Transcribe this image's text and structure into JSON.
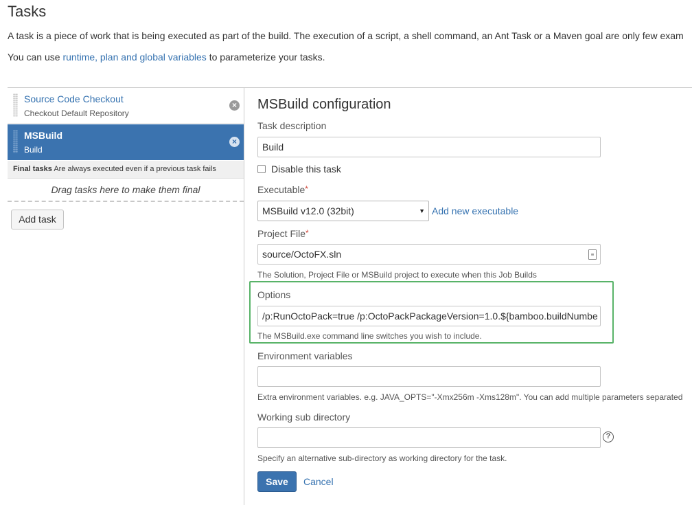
{
  "page": {
    "title": "Tasks",
    "intro": "A task is a piece of work that is being executed as part of the build. The execution of a script, a shell command, an Ant Task or a Maven goal are only few exam",
    "vars_prefix": "You can use ",
    "vars_link": "runtime, plan and global variables",
    "vars_suffix": " to parameterize your tasks."
  },
  "tasks": [
    {
      "name": "Source Code Checkout",
      "sub": "Checkout Default Repository",
      "remove_glyph": "×"
    },
    {
      "name": "MSBuild",
      "sub": "Build",
      "remove_glyph": "×"
    }
  ],
  "final_tasks": {
    "title": "Final tasks",
    "description": "Are always executed even if a previous task fails",
    "drop_hint": "Drag tasks here to make them final"
  },
  "add_task_label": "Add task",
  "config": {
    "title": "MSBuild configuration",
    "task_description_label": "Task description",
    "task_description_value": "Build",
    "disable_label": "Disable this task",
    "executable_label": "Executable",
    "required_mark": "*",
    "executable_value": "MSBuild v12.0 (32bit)",
    "add_executable": "Add new executable",
    "project_file_label": "Project File",
    "project_file_value": "source/OctoFX.sln",
    "project_file_help": "The Solution, Project File or MSBuild project to execute when this Job Builds",
    "options_label": "Options",
    "options_value": "/p:RunOctoPack=true /p:OctoPackPackageVersion=1.0.${bamboo.buildNumbe",
    "options_help": "The MSBuild.exe command line switches you wish to include.",
    "env_label": "Environment variables",
    "env_value": "",
    "env_help": "Extra environment variables. e.g. JAVA_OPTS=\"-Xmx256m -Xms128m\". You can add multiple parameters separated",
    "working_dir_label": "Working sub directory",
    "working_dir_value": "",
    "working_dir_help": "Specify an alternative sub-directory as working directory for the task.",
    "help_glyph": "?",
    "save_label": "Save",
    "cancel_label": "Cancel"
  },
  "icons": {
    "select_caret": "▼",
    "file_picker": "≡"
  },
  "colors": {
    "accent": "#3b73af",
    "link": "#3572b0",
    "highlight_border": "#58b368",
    "required": "#d04437"
  }
}
